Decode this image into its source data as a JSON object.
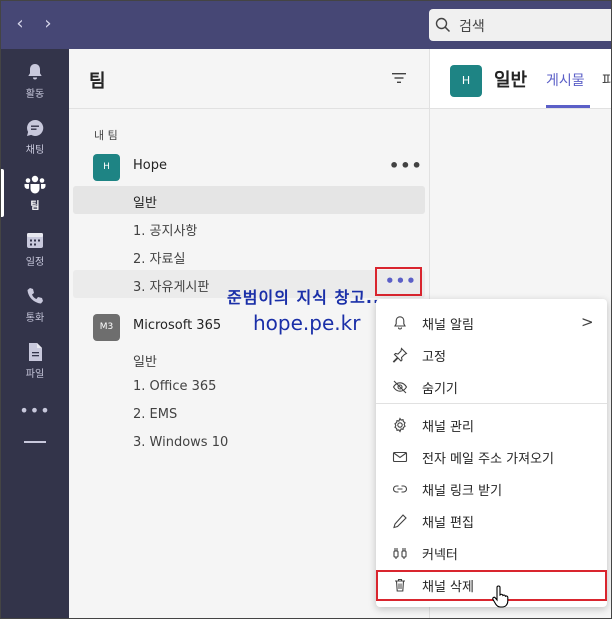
{
  "search": {
    "placeholder": "검색"
  },
  "app_bar": {
    "items": [
      {
        "label": "활동",
        "icon": "bell-icon"
      },
      {
        "label": "채팅",
        "icon": "chat-icon"
      },
      {
        "label": "팀",
        "icon": "teams-icon",
        "active": true
      },
      {
        "label": "일정",
        "icon": "calendar-icon"
      },
      {
        "label": "통화",
        "icon": "phone-icon"
      },
      {
        "label": "파일",
        "icon": "file-icon"
      }
    ],
    "more": "•••"
  },
  "teams_pane": {
    "title": "팀",
    "section_label": "내 팀",
    "teams": [
      {
        "name": "Hope",
        "avatar": "H",
        "avatar_color": "#1e8484",
        "more": "•••",
        "channels": [
          {
            "name": "일반",
            "selected": true
          },
          {
            "name": "1. 공지사항"
          },
          {
            "name": "2. 자료실"
          },
          {
            "name": "3. 자유게시판",
            "hover": true,
            "more": "•••"
          }
        ]
      },
      {
        "name": "Microsoft 365",
        "avatar": "M3",
        "avatar_color": "#6e6e6e",
        "channels": [
          {
            "name": "일반"
          },
          {
            "name": "1. Office 365"
          },
          {
            "name": "2. EMS"
          },
          {
            "name": "3. Windows 10"
          }
        ]
      }
    ]
  },
  "watermark": {
    "line1": "준범이의 지식 창고..",
    "line2": "hope.pe.kr"
  },
  "channel_header": {
    "avatar": "H",
    "title": "일반",
    "tab_active": "게시물",
    "tab_next": "파"
  },
  "context_menu": {
    "items": [
      {
        "label": "채널 알림",
        "icon": "bell-icon",
        "has_submenu": true
      },
      {
        "label": "고정",
        "icon": "pin-icon"
      },
      {
        "label": "숨기기",
        "icon": "eye-off-icon"
      },
      {
        "label": "채널 관리",
        "icon": "gear-icon"
      },
      {
        "label": "전자 메일 주소 가져오기",
        "icon": "mail-icon"
      },
      {
        "label": "채널 링크 받기",
        "icon": "link-icon"
      },
      {
        "label": "채널 편집",
        "icon": "pencil-icon"
      },
      {
        "label": "커넥터",
        "icon": "connector-icon"
      },
      {
        "label": "채널 삭제",
        "icon": "trash-icon",
        "highlighted": true
      }
    ],
    "chevron": ">"
  },
  "colors": {
    "titlebar": "#464775",
    "appbar": "#33344a",
    "accent": "#5b5fc7",
    "highlight": "#d9252e",
    "watermark": "#1a2fa8"
  }
}
